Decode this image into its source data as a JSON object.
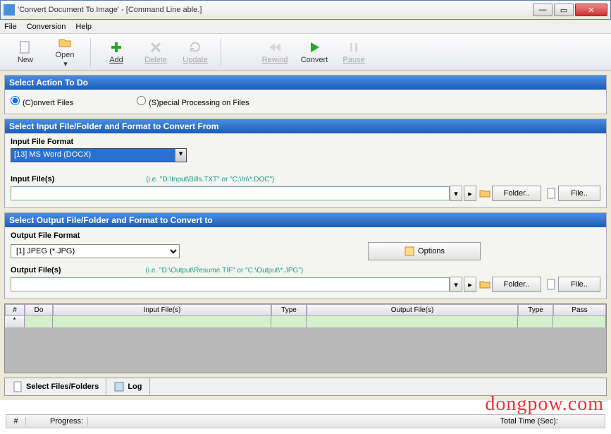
{
  "title": "'Convert Document To Image' - [Command Line able.]",
  "menu": {
    "file": "File",
    "conversion": "Conversion",
    "help": "Help"
  },
  "tb": {
    "new": "New",
    "open": "Open",
    "add": "Add",
    "delete": "Delete",
    "update": "Update",
    "rewind": "Rewind",
    "convert": "Convert",
    "pause": "Pause"
  },
  "hdr1": "Select Action To Do",
  "action": {
    "convert": "(C)onvert Files",
    "special": "(S)pecial Processing on Files"
  },
  "hdr2": "Select Input File/Folder and Format to Convert From",
  "inFmtLbl": "Input File Format",
  "inFmt": "[13] MS Word (DOCX)",
  "inFilesLbl": "Input File(s)",
  "inHint": "(i.e. \"D:\\Input\\Bills.TXT\" or \"C:\\In\\*.DOC\")",
  "folderBtn": "Folder..",
  "fileBtn": "File..",
  "hdr3": "Select Output File/Folder and Format to Convert to",
  "outFmtLbl": "Output File Format",
  "outFmt": "[1] JPEG (*.JPG)",
  "optionsBtn": "Options",
  "outFilesLbl": "Output File(s)",
  "outHint": "(i.e. \"D:\\Output\\Resume.TIF\" or \"C:\\Output\\*.JPG\")",
  "grid": {
    "h0": "#",
    "h1": "Do",
    "h2": "Input File(s)",
    "h3": "Type",
    "h4": "Output File(s)",
    "h5": "Type",
    "h6": "Pass",
    "star": "*"
  },
  "tabs": {
    "sel": "Select Files/Folders",
    "log": "Log"
  },
  "status": {
    "num": "#",
    "progress": "Progress:",
    "total": "Total Time (Sec):"
  },
  "watermark": "dongpow.com"
}
